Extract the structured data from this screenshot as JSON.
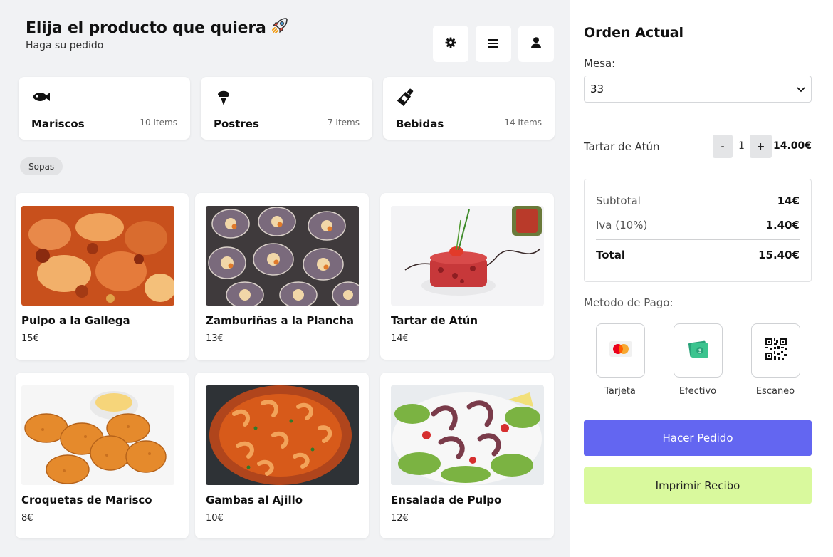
{
  "header": {
    "title": "Elija el producto que quiera",
    "subtitle": "Haga su pedido"
  },
  "toolbar": {
    "icons": [
      "gear-icon",
      "menu-icon",
      "user-icon"
    ]
  },
  "categories": [
    {
      "name": "Mariscos",
      "count": "10 Items",
      "icon": "fish-icon"
    },
    {
      "name": "Postres",
      "count": "7 Items",
      "icon": "ice-cream-icon"
    },
    {
      "name": "Bebidas",
      "count": "14 Items",
      "icon": "bottle-icon"
    }
  ],
  "filter_chip": "Sopas",
  "products": [
    {
      "name": "Pulpo a la Gallega",
      "price": "15€"
    },
    {
      "name": "Zamburiñas a la Plancha",
      "price": "13€"
    },
    {
      "name": "Tartar de Atún",
      "price": "14€"
    },
    {
      "name": "Croquetas de Marisco",
      "price": "8€"
    },
    {
      "name": "Gambas al Ajillo",
      "price": "10€"
    },
    {
      "name": "Ensalada de Pulpo",
      "price": "12€"
    }
  ],
  "order": {
    "title": "Orden Actual",
    "mesa_label": "Mesa:",
    "mesa_value": "33",
    "item": {
      "name": "Tartar de Atún",
      "minus": "-",
      "qty": "1",
      "plus": "+",
      "price": "14.00€"
    },
    "summary": {
      "subtotal_label": "Subtotal",
      "subtotal_value": "14€",
      "iva_label": "Iva (10%)",
      "iva_value": "1.40€",
      "total_label": "Total",
      "total_value": "15.40€"
    },
    "payment_label": "Metodo de Pago:",
    "payment_methods": [
      {
        "label": "Tarjeta",
        "icon": "credit-card-icon"
      },
      {
        "label": "Efectivo",
        "icon": "cash-icon"
      },
      {
        "label": "Escaneo",
        "icon": "qr-code-icon"
      }
    ],
    "order_button": "Hacer Pedido",
    "print_button": "Imprimir Recibo"
  },
  "colors": {
    "accent": "#6366f1",
    "print": "#d9f99d",
    "background": "#f1f2f4"
  }
}
